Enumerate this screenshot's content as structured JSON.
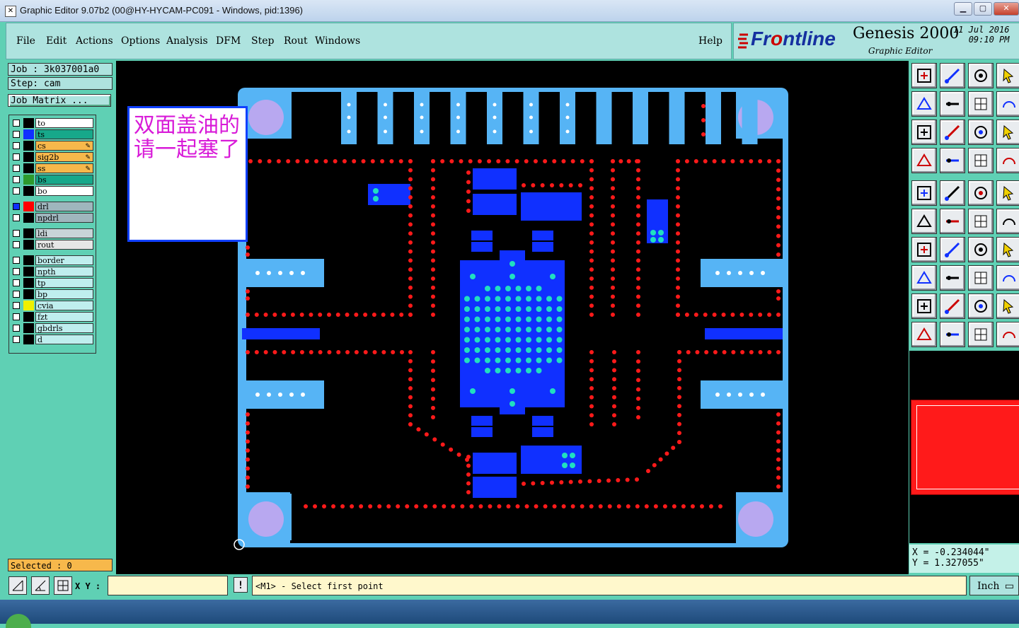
{
  "window": {
    "title": "Graphic Editor 9.07b2 (00@HY-HYCAM-PC091 - Windows, pid:1396)",
    "icon": "app-icon-x",
    "controls": [
      "minimize-icon",
      "maximize-icon",
      "close-icon"
    ]
  },
  "menu": {
    "items": [
      "File",
      "Edit",
      "Actions",
      "Options",
      "Analysis",
      "DFM",
      "Step",
      "Rout",
      "Windows"
    ],
    "help": "Help"
  },
  "brand": {
    "logo_prefix": "Fr",
    "logo_accent": "o",
    "logo_suffix": "ntline",
    "product": "Genesis 2000",
    "subtitle": "Graphic Editor",
    "date": "11 Jul 2016",
    "time": "09:10 PM"
  },
  "job": {
    "job_label": "Job : 3k037001a0",
    "step_label": "Step: cam",
    "matrix_button": "Job Matrix ..."
  },
  "layers": [
    {
      "name": "to",
      "color": "#000000",
      "bg": "#ffffff",
      "editable": false
    },
    {
      "name": "ts",
      "color": "#1030ff",
      "bg": "#17a88a",
      "editable": false
    },
    {
      "name": "cs",
      "color": "#000000",
      "bg": "#f7b84b",
      "editable": true
    },
    {
      "name": "sig2b",
      "color": "#000000",
      "bg": "#f7b84b",
      "editable": true
    },
    {
      "name": "ss",
      "color": "#000000",
      "bg": "#f7b84b",
      "editable": true
    },
    {
      "name": "bs",
      "color": "#2d9a2d",
      "bg": "#17a88a",
      "editable": false
    },
    {
      "name": "bo",
      "color": "#000000",
      "bg": "#ffffff",
      "editable": false
    },
    {
      "name": "drl",
      "color": "#ff0000",
      "bg": "#9fb6bd",
      "editable": false,
      "active": true
    },
    {
      "name": "npdrl",
      "color": "#000000",
      "bg": "#9fb6bd",
      "editable": false
    },
    {
      "name": "ldi",
      "color": "#000000",
      "bg": "#c8d4d8",
      "editable": false
    },
    {
      "name": "rout",
      "color": "#000000",
      "bg": "#e6e6e6",
      "editable": false
    },
    {
      "name": "border",
      "color": "#000000",
      "bg": "#bfeeee",
      "editable": false
    },
    {
      "name": "npth",
      "color": "#000000",
      "bg": "#bfeeee",
      "editable": false
    },
    {
      "name": "tp",
      "color": "#000000",
      "bg": "#bfeeee",
      "editable": false
    },
    {
      "name": "bp",
      "color": "#000000",
      "bg": "#bfeeee",
      "editable": false
    },
    {
      "name": "cvia",
      "color": "#f0f000",
      "bg": "#bfeeee",
      "editable": false
    },
    {
      "name": "fzt",
      "color": "#000000",
      "bg": "#bfeeee",
      "editable": false
    },
    {
      "name": "gbdrls",
      "color": "#000000",
      "bg": "#bfeeee",
      "editable": false
    },
    {
      "name": "d",
      "color": "#000000",
      "bg": "#bfeeee",
      "editable": false
    }
  ],
  "selected": "Selected : 0",
  "note": {
    "text": "双面盖油的请一起塞了"
  },
  "colors": {
    "board": "#56b4f5",
    "copper": "#1030ff",
    "drill": "#ff1a1a",
    "pad": "#20e0c0",
    "hole": "#b8a8f0"
  },
  "coords": {
    "x": "X = -0.234044\"",
    "y": "Y = 1.327055\""
  },
  "bottom": {
    "xy_label": "X Y :",
    "xy_value": "",
    "excl": "!",
    "status": "<M1> - Select first point",
    "unit": "Inch"
  },
  "toolbar_icons": [
    "open-step-icon",
    "save-icon",
    "home-icon",
    "window-layout-icon",
    "zoom-in-icon",
    "zoom-out-icon",
    "zoom-home-icon",
    "help-question-icon",
    "fit-all-icon",
    "pan-icon",
    "scale-1-2-icon",
    "query-icon",
    "measure-icon",
    "pad-icon",
    "route-icon",
    "net-icon",
    "add-pad-icon",
    "add-surface-icon",
    "ruler-icon",
    "circle-icon",
    "connect-icon",
    "delete-icon",
    "snap-icon",
    "arc-icon",
    "line-angle-icon",
    "line-icon",
    "rotate-icon",
    "mirror-icon",
    "move-icon",
    "line-red-icon",
    "grid-icon",
    "copy-icon",
    "text-triangle-icon",
    "text-a-icon",
    "text-arc-icon",
    "text-line-icon",
    "select-icon",
    "select-box-icon",
    "select-net-icon",
    "select-multi-icon"
  ]
}
